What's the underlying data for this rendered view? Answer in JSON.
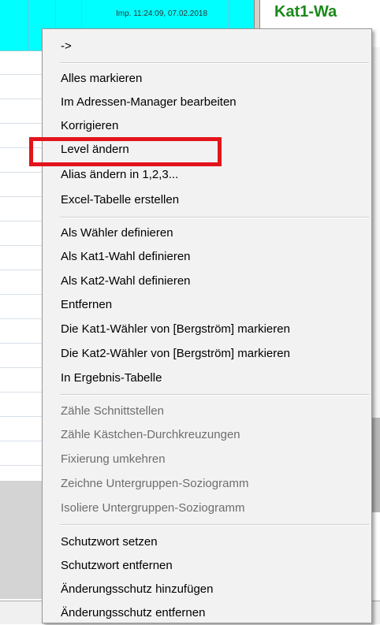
{
  "window": {
    "timestamp_label": "Imp. 11:24:09, 07.02.2018",
    "right_title": "Kat1-Wa"
  },
  "menu": {
    "items": [
      {
        "label": "->",
        "enabled": true
      },
      {
        "label": "Alles markieren",
        "enabled": true
      },
      {
        "label": "Im Adressen-Manager bearbeiten",
        "enabled": true
      },
      {
        "label": "Korrigieren",
        "enabled": true
      },
      {
        "label": "Level ändern",
        "enabled": true
      },
      {
        "label": "Alias ändern in 1,2,3...",
        "enabled": true
      },
      {
        "label": "Excel-Tabelle erstellen",
        "enabled": true
      },
      {
        "label": "Als Wähler definieren",
        "enabled": true
      },
      {
        "label": "Als Kat1-Wahl definieren",
        "enabled": true
      },
      {
        "label": "Als Kat2-Wahl definieren",
        "enabled": true
      },
      {
        "label": "Entfernen",
        "enabled": true
      },
      {
        "label": "Die Kat1-Wähler von [Bergström] markieren",
        "enabled": true
      },
      {
        "label": "Die Kat2-Wähler von [Bergström] markieren",
        "enabled": true
      },
      {
        "label": "In Ergebnis-Tabelle",
        "enabled": true
      },
      {
        "label": "Zähle Schnittstellen",
        "enabled": false
      },
      {
        "label": "Zähle Kästchen-Durchkreuzungen",
        "enabled": false
      },
      {
        "label": "Fixierung umkehren",
        "enabled": false
      },
      {
        "label": "Zeichne Untergruppen-Soziogramm",
        "enabled": false
      },
      {
        "label": "Isoliere Untergruppen-Soziogramm",
        "enabled": false
      },
      {
        "label": "Schutzwort setzen",
        "enabled": true
      },
      {
        "label": "Schutzwort entfernen",
        "enabled": true
      },
      {
        "label": "Änderungsschutz hinzufügen",
        "enabled": true
      },
      {
        "label": "Änderungsschutz entfernen",
        "enabled": true
      }
    ]
  },
  "highlight": {
    "target": "Level ändern",
    "color": "#e3141c"
  },
  "colors": {
    "grid_header": "#00ffff",
    "title_green": "#1a8a1a",
    "menu_bg": "#f2f2f2"
  }
}
